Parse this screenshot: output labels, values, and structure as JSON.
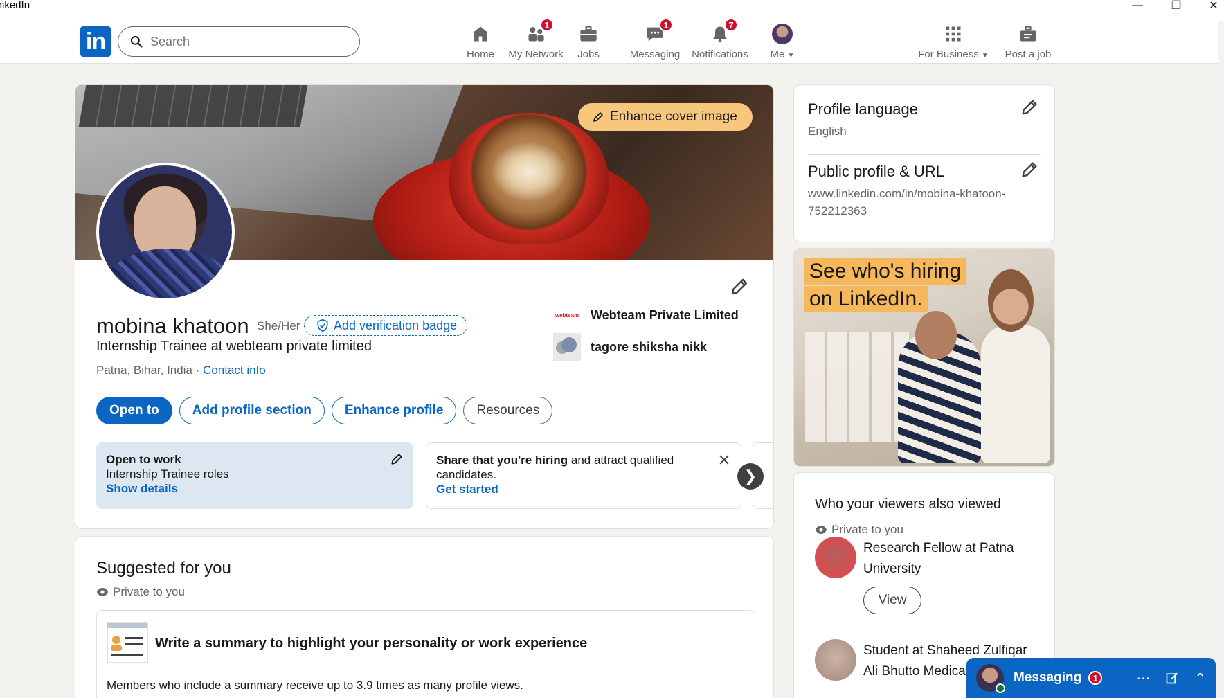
{
  "window": {
    "title": "nkedIn"
  },
  "nav": {
    "search_placeholder": "Search",
    "items": [
      {
        "label": "Home",
        "icon": "home-icon"
      },
      {
        "label": "My Network",
        "icon": "network-icon",
        "badge": "1"
      },
      {
        "label": "Jobs",
        "icon": "briefcase-icon"
      },
      {
        "label": "Messaging",
        "icon": "chat-icon",
        "badge": "1"
      },
      {
        "label": "Notifications",
        "icon": "bell-icon",
        "badge": "7"
      },
      {
        "label": "Me",
        "icon": "avatar"
      },
      {
        "label": "For Business",
        "icon": "grid-icon"
      },
      {
        "label": "Post a job",
        "icon": "post-job-icon"
      }
    ]
  },
  "profile": {
    "enhance_cover_label": "Enhance cover image",
    "name": "mobina khatoon",
    "pronouns": "She/Her",
    "verify_label": "Add verification badge",
    "headline": "Internship Trainee at webteam private limited",
    "location": "Patna, Bihar, India",
    "location_sep": " · ",
    "contact_label": "Contact info",
    "companies": [
      {
        "name": "Webteam Private Limited",
        "logo_text": "webteam"
      },
      {
        "name": "tagore shiksha nikk"
      }
    ],
    "actions": {
      "open_to": "Open to",
      "add_section": "Add profile section",
      "enhance": "Enhance profile",
      "resources": "Resources"
    },
    "open_to_work": {
      "title": "Open to work",
      "subtitle": "Internship Trainee roles",
      "link": "Show details"
    },
    "share_hiring": {
      "title_bold": "Share that you're hiring",
      "title_rest": " and attract qualified candidates.",
      "link": "Get started"
    }
  },
  "suggested": {
    "title": "Suggested for you",
    "private_label": "Private to you",
    "item_title": "Write a summary to highlight your personality or work experience",
    "item_desc": "Members who include a summary receive up to 3.9 times as many profile views."
  },
  "sidebar": {
    "profile_language_title": "Profile language",
    "profile_language_value": "English",
    "public_profile_title": "Public profile & URL",
    "public_profile_url": "www.linkedin.com/in/mobina-khatoon-752212363",
    "ad_line1": "See who's hiring",
    "ad_line2": "on LinkedIn.",
    "viewers_title": "Who your viewers also viewed",
    "viewers_private": "Private to you",
    "viewers": [
      {
        "text": "Research Fellow at Patna University",
        "button": "View"
      },
      {
        "text": "Student at Shaheed Zulfiqar Ali Bhutto Medical University"
      }
    ]
  },
  "messaging": {
    "label": "Messaging",
    "badge": "1"
  },
  "colors": {
    "brand": "#0a66c2",
    "badge": "#cb112d",
    "cover_button": "#f8c77e",
    "ad_highlight": "#f6b85b"
  }
}
